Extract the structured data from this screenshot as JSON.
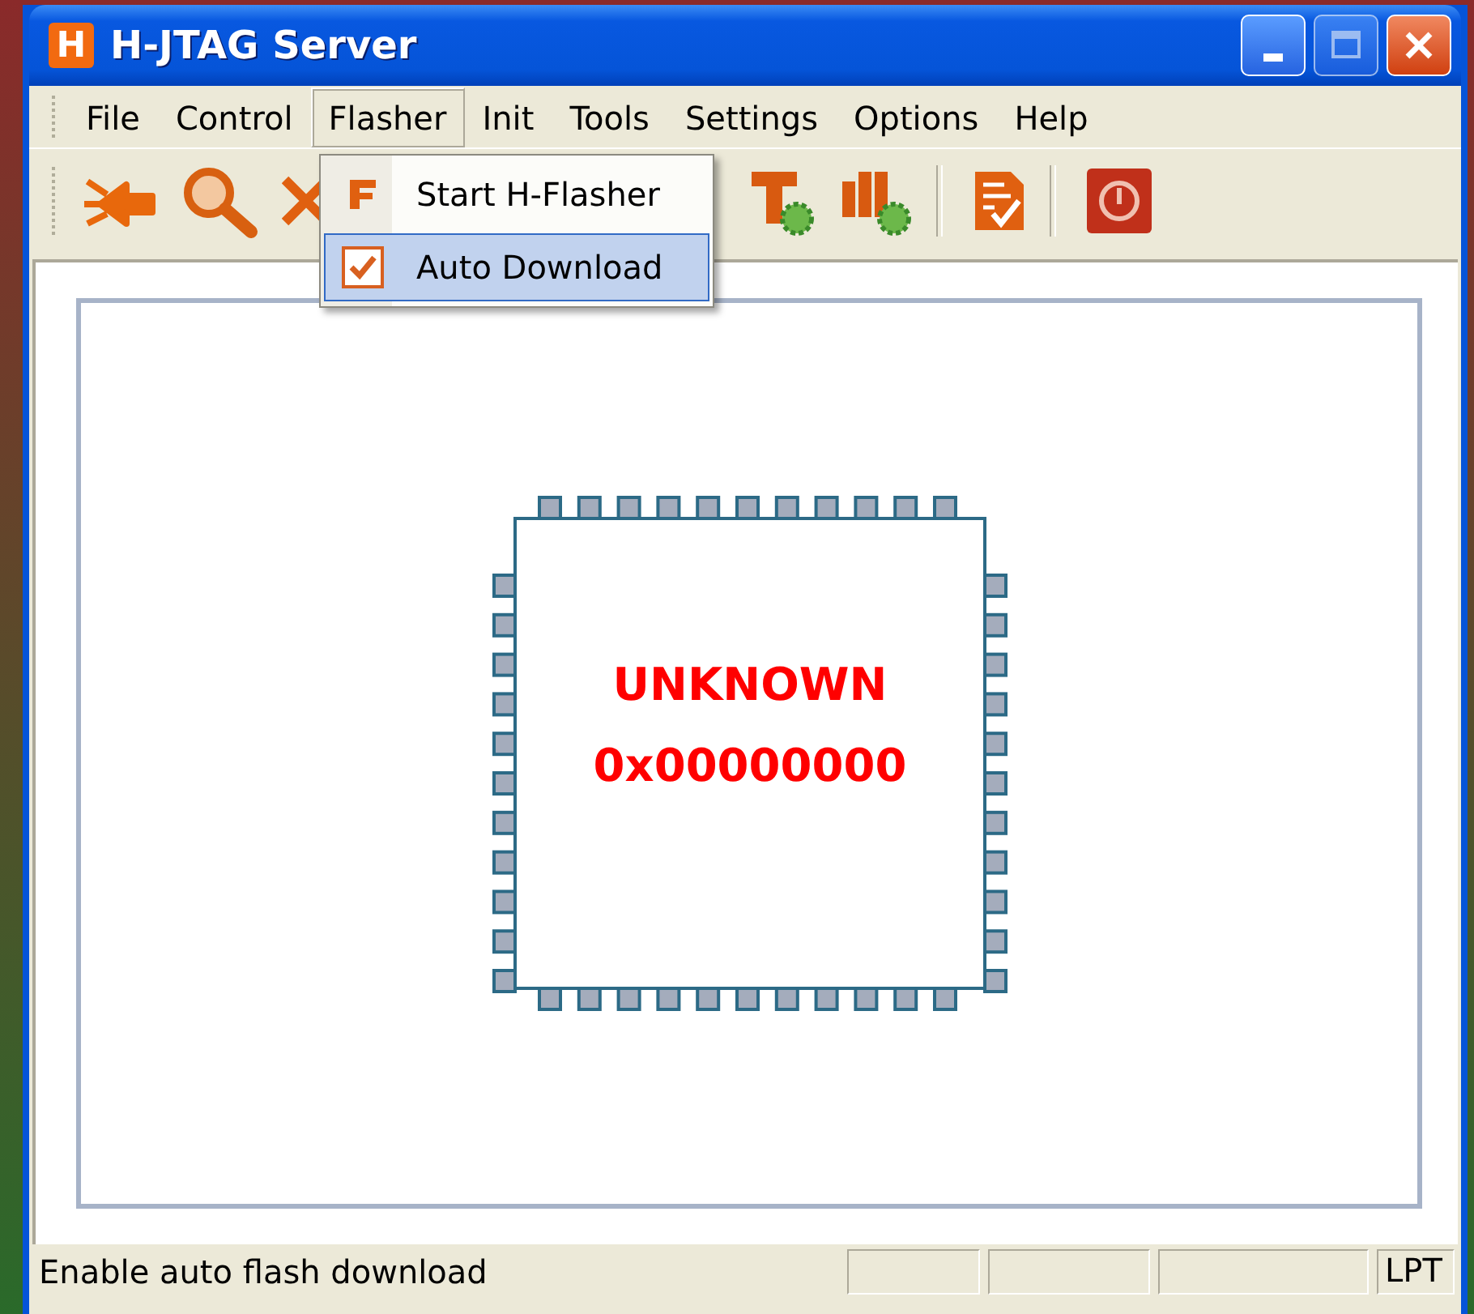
{
  "window": {
    "logo": "H",
    "title": "H-JTAG Server"
  },
  "menu": [
    {
      "label": "File",
      "selected": false
    },
    {
      "label": "Control",
      "selected": false
    },
    {
      "label": "Flasher",
      "selected": true
    },
    {
      "label": "Init",
      "selected": false
    },
    {
      "label": "Tools",
      "selected": false
    },
    {
      "label": "Settings",
      "selected": false
    },
    {
      "label": "Options",
      "selected": false
    },
    {
      "label": "Help",
      "selected": false
    }
  ],
  "dropdown": [
    {
      "kind": "command",
      "label": "Start H-Flasher",
      "highlighted": false
    },
    {
      "kind": "toggle",
      "label": "Auto Download",
      "checked": true,
      "highlighted": true
    }
  ],
  "chip": {
    "name": "UNKNOWN",
    "id": "0x00000000"
  },
  "status_bar": {
    "message": "Enable auto flash download",
    "port": "LPT"
  }
}
